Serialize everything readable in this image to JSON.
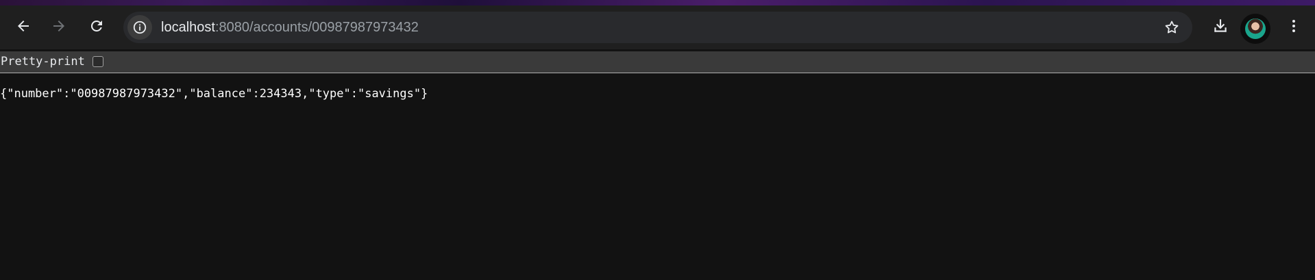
{
  "browser": {
    "address_bar": {
      "host": "localhost",
      "path": ":8080/accounts/00987987973432"
    },
    "icons": {
      "back": "arrow-left-icon",
      "forward": "arrow-right-icon",
      "reload": "reload-icon",
      "site_info": "info-icon",
      "bookmark": "star-icon",
      "downloads": "download-icon",
      "profile": "avatar",
      "menu": "kebab-menu-icon"
    }
  },
  "viewer": {
    "pretty_print_label": "Pretty-print",
    "pretty_print_checked": false,
    "json_text": "{\"number\":\"00987987973432\",\"balance\":234343,\"type\":\"savings\"}"
  }
}
